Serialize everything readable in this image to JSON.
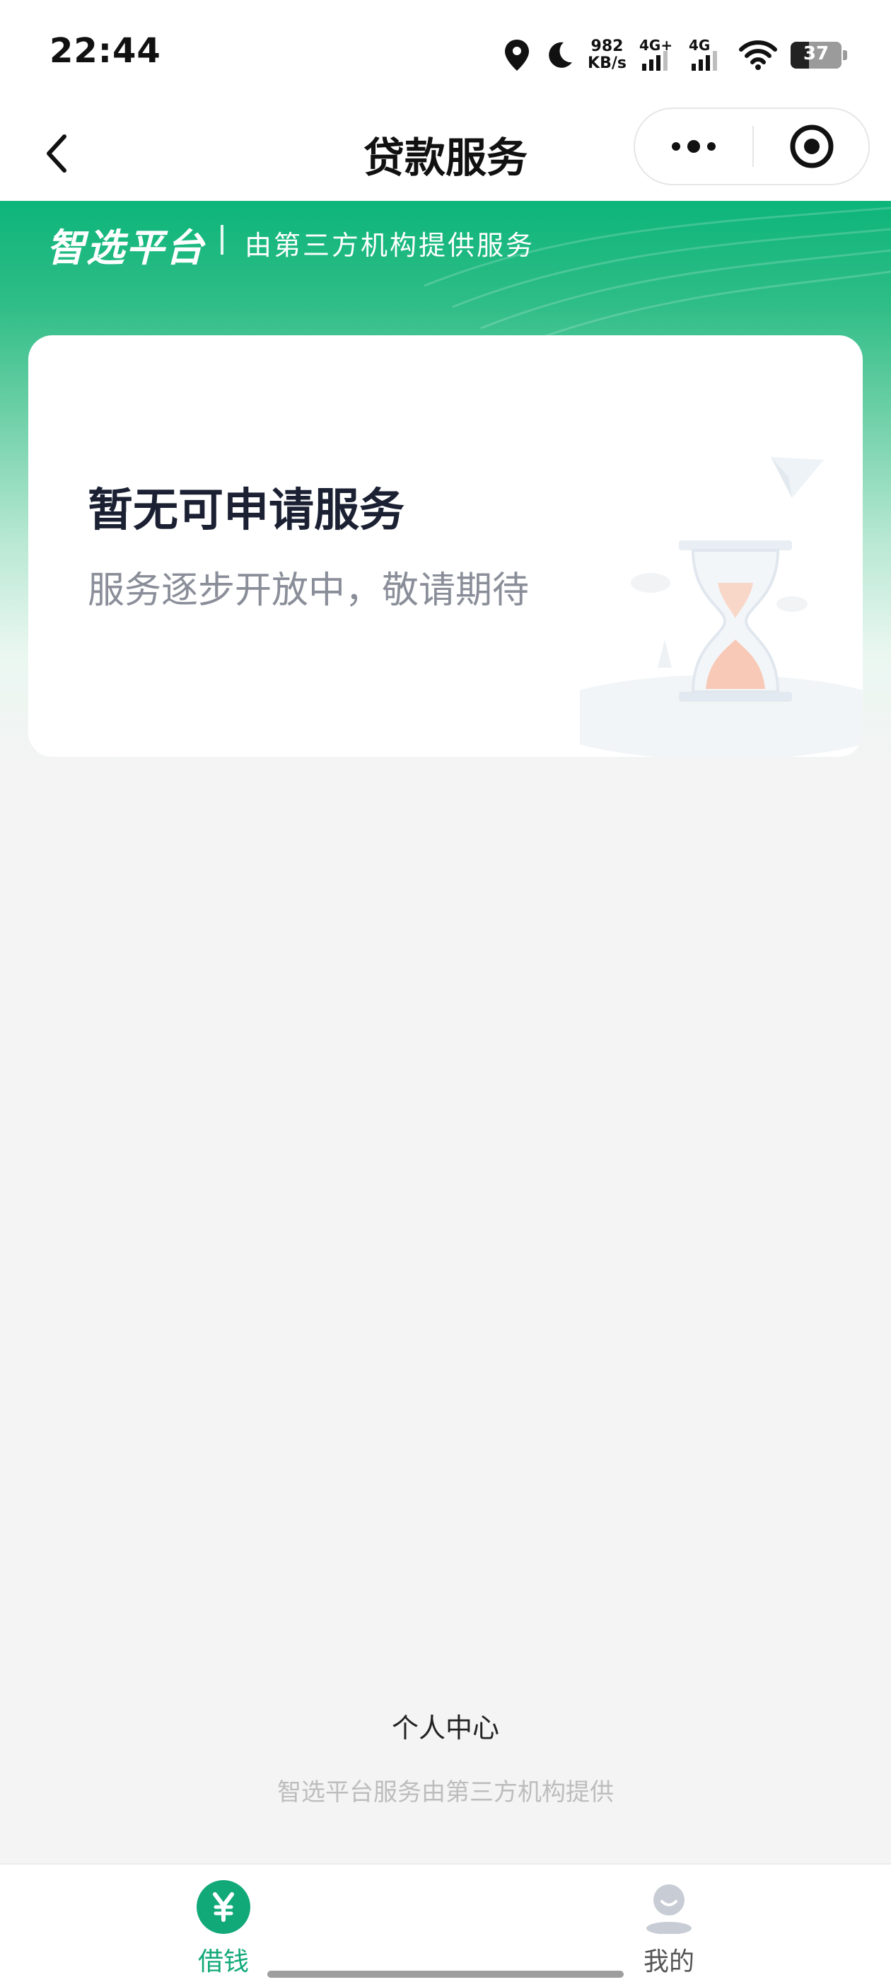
{
  "status_bar": {
    "time": "22:44",
    "net_speed_value": "982",
    "net_speed_unit": "KB/s",
    "signal_1_label": "4G+",
    "signal_2_label": "4G",
    "battery_level": "37",
    "icons": [
      "location-icon",
      "moon-icon",
      "signal-icon",
      "wifi-icon",
      "battery-icon"
    ]
  },
  "header": {
    "title": "贷款服务",
    "back_icon": "chevron-left-icon",
    "more_icon": "more-dots-icon",
    "target_icon": "target-icon"
  },
  "banner": {
    "brand": "智选平台",
    "tagline": "由第三方机构提供服务"
  },
  "card": {
    "title": "暂无可申请服务",
    "subtitle": "服务逐步开放中，敬请期待",
    "illustration": "hourglass-illustration"
  },
  "footer": {
    "link": "个人中心",
    "note": "智选平台服务由第三方机构提供"
  },
  "tabs": [
    {
      "label": "借钱",
      "icon": "yen-icon",
      "active": true
    },
    {
      "label": "我的",
      "icon": "profile-icon",
      "active": false
    }
  ],
  "colors": {
    "accent": "#12a979",
    "banner_top": "#0db57a",
    "background": "#f4f4f4",
    "card_title": "#1b2133",
    "card_subtitle": "#8a8e99"
  }
}
